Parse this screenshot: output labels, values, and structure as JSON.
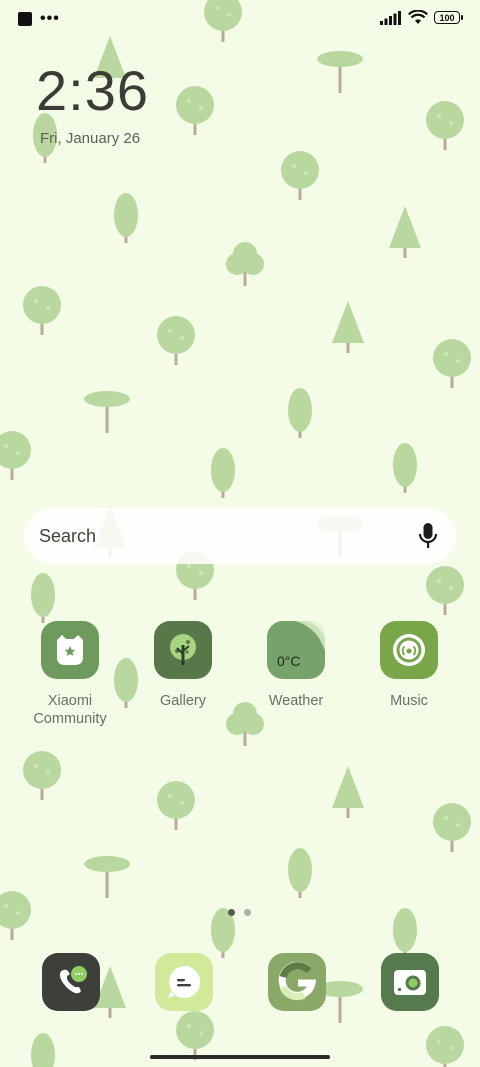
{
  "status_bar": {
    "left_icons": [
      "notification-square-icon",
      "more-dots-icon"
    ],
    "more_text": "•••",
    "right_icons": [
      "signal-icon",
      "wifi-icon",
      "battery-icon"
    ],
    "battery_level": "100"
  },
  "lockclock": {
    "time": "2:36",
    "date": "Fri, January 26"
  },
  "search": {
    "label": "Search",
    "icon": "mic-icon"
  },
  "apps": [
    {
      "label": "Xiaomi\nCommunity",
      "icon": "xiaomi-community-icon",
      "color": "#6f9a5e"
    },
    {
      "label": "Gallery",
      "icon": "gallery-tree-icon",
      "color": "#58784a"
    },
    {
      "label": "Weather",
      "icon": "weather-icon",
      "color": "#76a26c",
      "temp": "0°C"
    },
    {
      "label": "Music",
      "icon": "music-icon",
      "color": "#7aa64a"
    }
  ],
  "page_indicator": {
    "count": 2,
    "active": 0
  },
  "dock": [
    {
      "name": "phone",
      "icon": "phone-icon",
      "color": "#3d3f3a"
    },
    {
      "name": "messages",
      "icon": "messages-icon",
      "color": "#d2e99a"
    },
    {
      "name": "google",
      "icon": "google-icon",
      "color": "#8aa868"
    },
    {
      "name": "camera",
      "icon": "camera-icon",
      "color": "#567a4d"
    }
  ],
  "colors": {
    "background": "#f4fbe7",
    "tree_light": "#cfe6b4",
    "tree_mid": "#b8d8a0",
    "trunk": "#b9ab9a"
  }
}
